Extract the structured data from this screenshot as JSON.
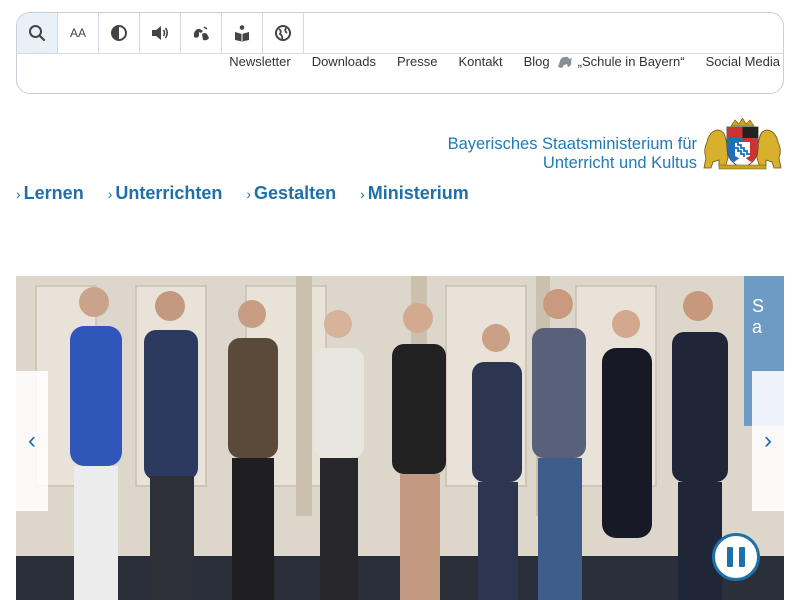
{
  "toolbar": {
    "buttons": [
      {
        "icon": "search-icon"
      },
      {
        "icon": "font-size-icon",
        "label": "AA"
      },
      {
        "icon": "contrast-icon"
      },
      {
        "icon": "speaker-icon"
      },
      {
        "icon": "sign-language-icon"
      },
      {
        "icon": "easy-language-icon"
      },
      {
        "icon": "language-globe-icon"
      }
    ]
  },
  "metanav": {
    "newsletter": "Newsletter",
    "downloads": "Downloads",
    "presse": "Presse",
    "kontakt": "Kontakt",
    "blog": "Blog",
    "blog_title": "„Schule in Bayern“",
    "social": "Social Media"
  },
  "ministry": {
    "line1": "Bayerisches Staatsministerium für",
    "line2": "Unterricht und Kultus"
  },
  "mainnav": {
    "items": [
      {
        "label": "Lernen"
      },
      {
        "label": "Unterrichten"
      },
      {
        "label": "Gestalten"
      },
      {
        "label": "Ministerium"
      }
    ]
  },
  "hero": {
    "screen_text": "S\na",
    "prev_icon": "chevron-left-icon",
    "next_icon": "chevron-right-icon",
    "pause_icon": "pause-icon"
  },
  "colors": {
    "brand_blue": "#1f7ab8",
    "nav_blue": "#1f6fa8"
  }
}
